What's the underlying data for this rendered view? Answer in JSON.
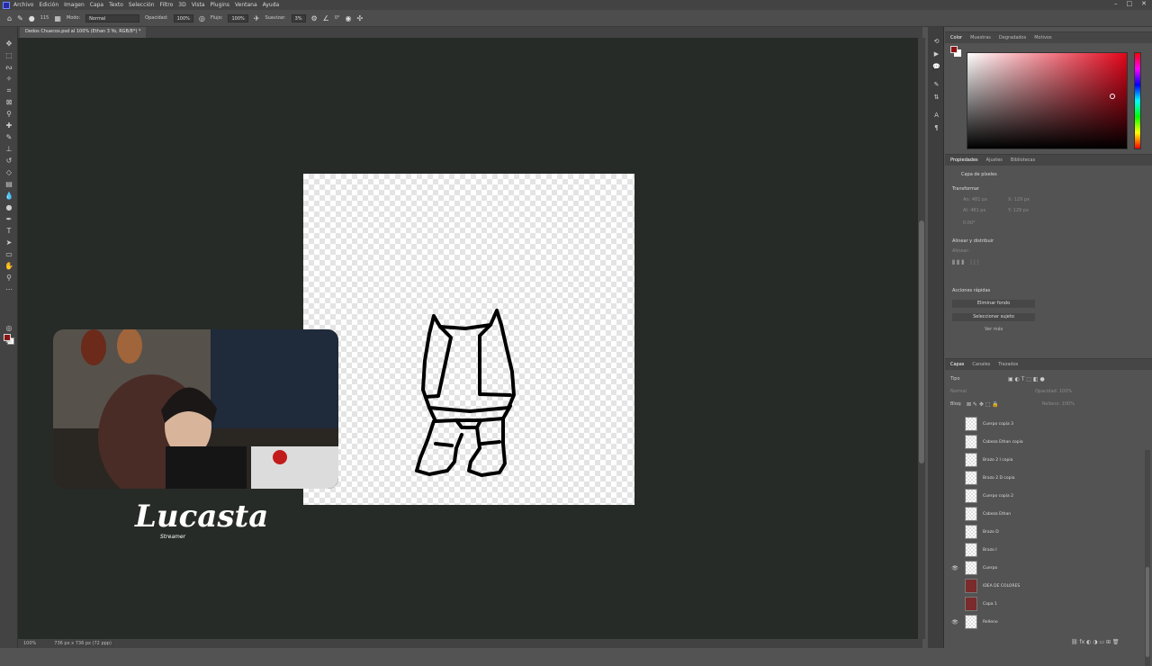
{
  "menu": {
    "items": [
      "Archivo",
      "Edición",
      "Imagen",
      "Capa",
      "Texto",
      "Selección",
      "Filtro",
      "3D",
      "Vista",
      "Plugins",
      "Ventana",
      "Ayuda"
    ],
    "window_controls": [
      "–",
      "□",
      "✕"
    ]
  },
  "options": {
    "mode_label": "Modo:",
    "mode_value": "Normal",
    "opacity_label": "Opacidad:",
    "opacity_value": "100%",
    "flow_label": "Flujo:",
    "flow_value": "100%",
    "smoothing_label": "Suavizar:",
    "smoothing_value": "3%",
    "angle_value": "0°",
    "brush_size": "115"
  },
  "document": {
    "tab_title": "Dedos Chuecos.psd al 100% (Ethan 3 Yo, RGB/8*) *"
  },
  "status": {
    "zoom": "100%",
    "doc_size": "736 px x 736 px (72 ppp)"
  },
  "overlay": {
    "brand_name": "Lucasta",
    "brand_sub": "Streamer"
  },
  "color_panel": {
    "tabs": [
      "Color",
      "Muestras",
      "Degradados",
      "Motivos"
    ],
    "fg_color": "#8c1414",
    "bg_color": "#ffffff"
  },
  "properties_panel": {
    "tabs": [
      "Propiedades",
      "Ajustes",
      "Bibliotecas"
    ],
    "layer_kind": "Capa de píxeles",
    "transform_title": "Transformar",
    "transform_w": "An: 481 px",
    "transform_x": "X: 129 px",
    "transform_h": "Al: 481 px",
    "transform_y": "Y: 129 px",
    "transform_angle": "0.00°",
    "align_title": "Alinear y distribuir",
    "align_sub": "Alinear:",
    "quick_actions_title": "Acciones rápidas",
    "remove_bg": "Eliminar fondo",
    "select_subject": "Seleccionar sujeto",
    "see_more": "Ver más"
  },
  "layers_panel": {
    "tabs": [
      "Capas",
      "Canales",
      "Trazados"
    ],
    "filter_label": "Tipo",
    "blend_mode": "Normal",
    "opacity_label": "Opacidad: 100%",
    "lock_label": "Bloq:",
    "fill_label": "Relleno: 100%",
    "layers": [
      {
        "name": "Cuerpo copia 3",
        "visible": false,
        "thumb": "transparent"
      },
      {
        "name": "Cabeza Ethan copia",
        "visible": false,
        "thumb": "transparent"
      },
      {
        "name": "Brazo 2 I copia",
        "visible": false,
        "thumb": "transparent"
      },
      {
        "name": "Brazo 2 D copia",
        "visible": false,
        "thumb": "transparent"
      },
      {
        "name": "Cuerpo copia 2",
        "visible": false,
        "thumb": "transparent"
      },
      {
        "name": "Cabeza Ethan",
        "visible": false,
        "thumb": "transparent"
      },
      {
        "name": "Brazo D",
        "visible": false,
        "thumb": "transparent"
      },
      {
        "name": "Brazo I",
        "visible": false,
        "thumb": "transparent"
      },
      {
        "name": "Cuerpo",
        "visible": true,
        "thumb": "transparent"
      },
      {
        "name": "IDEA DE COLORES",
        "visible": false,
        "thumb": "red"
      },
      {
        "name": "Capa 1",
        "visible": false,
        "thumb": "red"
      },
      {
        "name": "Relleno",
        "visible": true,
        "thumb": "transparent"
      }
    ]
  }
}
